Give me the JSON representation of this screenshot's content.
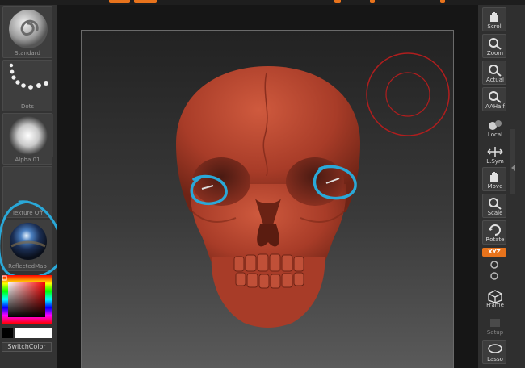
{
  "left_shelf": {
    "brush_label": "Standard",
    "stroke_label": "Dots",
    "alpha_label": "Alpha 01",
    "texture_label": "Texture Off",
    "material_label": "ReflectedMap",
    "switch_color_label": "SwitchColor"
  },
  "right_shelf": {
    "scroll_label": "Scroll",
    "zoom_label": "Zoom",
    "actual_label": "Actual",
    "aahalf_label": "AAHalf",
    "local_label": "Local",
    "lsym_label": "L.Sym",
    "move_label": "Move",
    "scale_label": "Scale",
    "rotate_label": "Rotate",
    "xyz_label": "XYZ",
    "frame_label": "Frame",
    "setup_label": "Setup",
    "lasso_label": "Lasso"
  },
  "colors": {
    "accent": "#e8731c",
    "skull": "#b4442c",
    "annotation": "#2aa8d8",
    "gizmo": "#b01e1e"
  }
}
